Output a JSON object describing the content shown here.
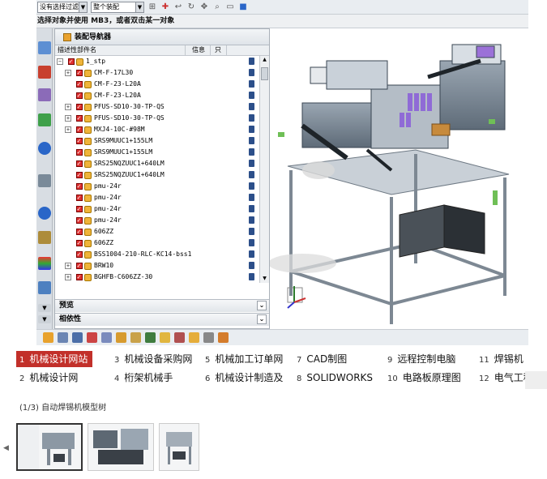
{
  "toolbar_top": {
    "filter_combo": "没有选择过滤器",
    "assembly_combo": "整个装配"
  },
  "cue_line": "选择对象并使用 MB3，或者双击某一对象",
  "navigator": {
    "title": "装配导航器",
    "columns": [
      "描述性部件名",
      "信息",
      "只"
    ],
    "root": "1_stp",
    "items": [
      {
        "label": "CM-F-17L30",
        "expandable": true
      },
      {
        "label": "CM-F-23-L20A",
        "expandable": false
      },
      {
        "label": "CM-F-23-L20A",
        "expandable": false
      },
      {
        "label": "PFUS-SD10-30-TP-QS",
        "expandable": true
      },
      {
        "label": "PFUS-SD10-30-TP-QS",
        "expandable": true
      },
      {
        "label": "MXJ4-10C-#98M",
        "expandable": true
      },
      {
        "label": "SRS9MUUC1+155LM",
        "expandable": false
      },
      {
        "label": "SRS9MUUC1+155LM",
        "expandable": false
      },
      {
        "label": "SRS25NQZUUC1+640LM",
        "expandable": false
      },
      {
        "label": "SRS25NQZUUC1+640LM",
        "expandable": false
      },
      {
        "label": "pmu-24r",
        "expandable": false
      },
      {
        "label": "pmu-24r",
        "expandable": false
      },
      {
        "label": "pmu-24r",
        "expandable": false
      },
      {
        "label": "pmu-24r",
        "expandable": false
      },
      {
        "label": "606ZZ",
        "expandable": false
      },
      {
        "label": "606ZZ",
        "expandable": false
      },
      {
        "label": "BSS1004-210-RLC-KC14-bss1",
        "expandable": false
      },
      {
        "label": "BRW10",
        "expandable": true
      },
      {
        "label": "BGHFB-C606ZZ-30",
        "expandable": true
      }
    ],
    "panel_preview": "预览",
    "panel_dependency": "相依性"
  },
  "keywords": [
    {
      "n": "1",
      "text": "机械设计网站",
      "active": true
    },
    {
      "n": "3",
      "text": "机械设备采购网"
    },
    {
      "n": "5",
      "text": "机械加工订单网"
    },
    {
      "n": "7",
      "text": "CAD制图"
    },
    {
      "n": "9",
      "text": "远程控制电脑"
    },
    {
      "n": "11",
      "text": "焊锡机"
    },
    {
      "n": "2",
      "text": "机械设计网"
    },
    {
      "n": "4",
      "text": "桁架机械手"
    },
    {
      "n": "6",
      "text": "机械设计制造及"
    },
    {
      "n": "8",
      "text": "SOLIDWORKS"
    },
    {
      "n": "10",
      "text": "电路板原理图"
    },
    {
      "n": "12",
      "text": "电气工程师"
    }
  ],
  "caption": "(1/3) 自动焊锡机模型树",
  "colors": {
    "accent": "#c2302a",
    "check": "#e03030",
    "frame": "#3a4b5c"
  }
}
